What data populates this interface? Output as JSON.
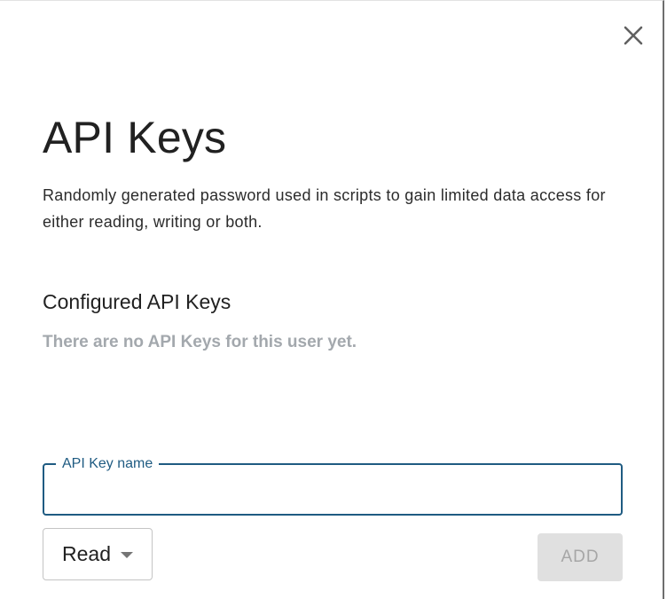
{
  "dialog": {
    "title": "API Keys",
    "description": "Randomly generated password used in scripts to gain limited data access for either reading, writing or both.",
    "close_icon": "close-icon"
  },
  "configured": {
    "heading": "Configured API Keys",
    "empty_message": "There are no API Keys for this user yet."
  },
  "form": {
    "name_field": {
      "label": "API Key name",
      "value": ""
    },
    "access_select": {
      "selected": "Read",
      "icon": "chevron-down-icon"
    },
    "add_label": "ADD",
    "add_enabled": false
  },
  "colors": {
    "accent": "#1f5b82",
    "muted_text": "#a3a8ad",
    "disabled_button_bg": "#e0e0e0",
    "disabled_button_text": "#a6a6a6"
  }
}
